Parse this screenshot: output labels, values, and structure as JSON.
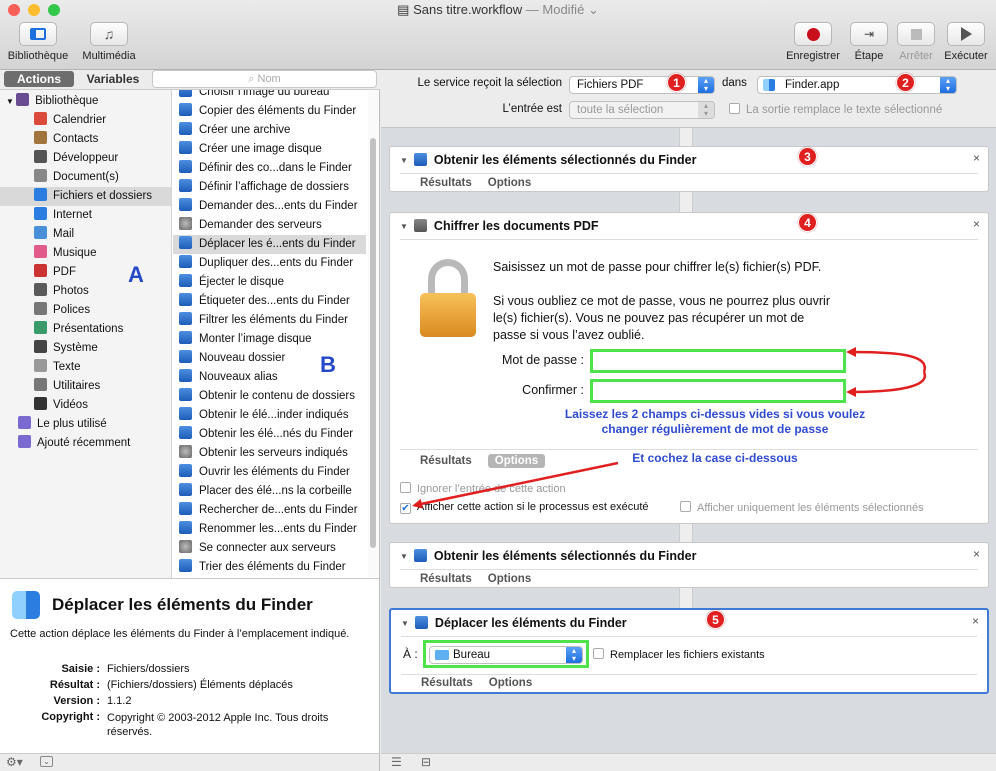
{
  "window": {
    "title": "Sans titre.workflow",
    "status": "— Modifié"
  },
  "toolbar": {
    "left": [
      {
        "label": "Bibliothèque"
      },
      {
        "label": "Multimédia"
      }
    ],
    "right": [
      {
        "label": "Enregistrer"
      },
      {
        "label": "Étape"
      },
      {
        "label": "Arrêter"
      },
      {
        "label": "Exécuter"
      }
    ]
  },
  "left": {
    "tab_actions": "Actions",
    "tab_variables": "Variables",
    "search_placeholder": "Nom",
    "library": [
      "Bibliothèque",
      "Calendrier",
      "Contacts",
      "Développeur",
      "Document(s)",
      "Fichiers et dossiers",
      "Internet",
      "Mail",
      "Musique",
      "PDF",
      "Photos",
      "Polices",
      "Présentations",
      "Système",
      "Texte",
      "Utilitaires",
      "Vidéos",
      "Le plus utilisé",
      "Ajouté récemment"
    ],
    "actions": [
      "Choisir l’image du bureau",
      "Copier des éléments du Finder",
      "Créer une archive",
      "Créer une image disque",
      "Définir des co...dans le Finder",
      "Définir l’affichage de dossiers",
      "Demander des...ents du Finder",
      "Demander des serveurs",
      "Déplacer les é...ents du Finder",
      "Dupliquer des...ents du Finder",
      "Éjecter le disque",
      "Étiqueter des...ents du Finder",
      "Filtrer les éléments du Finder",
      "Monter l’image disque",
      "Nouveau dossier",
      "Nouveaux alias",
      "Obtenir le contenu de dossiers",
      "Obtenir le élé...inder indiqués",
      "Obtenir les élé...nés du Finder",
      "Obtenir les serveurs indiqués",
      "Ouvrir les éléments du Finder",
      "Placer des élé...ns la corbeille",
      "Rechercher de...ents du Finder",
      "Renommer les...ents du Finder",
      "Se connecter aux serveurs",
      "Trier des éléments du Finder"
    ],
    "annot_a": "A",
    "annot_b": "B",
    "desc": {
      "title": "Déplacer les éléments du Finder",
      "text": "Cette action déplace les éléments du Finder à l’emplacement indiqué.",
      "saisie_label": "Saisie :",
      "saisie": "Fichiers/dossiers",
      "resultat_label": "Résultat :",
      "resultat": "(Fichiers/dossiers) Éléments déplacés",
      "version_label": "Version :",
      "version": "1.1.2",
      "copyright_label": "Copyright :",
      "copyright": "Copyright © 2003-2012 Apple Inc. Tous droits réservés."
    }
  },
  "service": {
    "receives_label": "Le service reçoit la sélection",
    "receives_value": "Fichiers PDF",
    "in_label": "dans",
    "app_value": "Finder.app",
    "input_label": "L’entrée est",
    "input_value": "toute la sélection",
    "replace_label": "La sortie remplace le texte sélectionné"
  },
  "cards": {
    "c1": {
      "title": "Obtenir les éléments sélectionnés du Finder",
      "tab1": "Résultats",
      "tab2": "Options"
    },
    "c2": {
      "title": "Chiffrer les documents PDF",
      "tab1": "Résultats",
      "tab2": "Options",
      "text1": "Saisissez un mot de passe pour chiffrer le(s) fichier(s) PDF.",
      "text2": "Si vous oubliez ce mot de passe, vous ne pourrez plus ouvrir le(s) fichier(s). Vous ne pouvez pas récupérer un mot de passe si vous l’avez oublié.",
      "password_label": "Mot de passe :",
      "confirm_label": "Confirmer :",
      "ignore_label": "Ignorer l’entrée de cette action",
      "show_label": "Afficher cette action si le processus est exécuté",
      "show_only_label": "Afficher uniquement les éléments sélectionnés"
    },
    "c3": {
      "title": "Obtenir les éléments sélectionnés du Finder",
      "tab1": "Résultats",
      "tab2": "Options"
    },
    "c4": {
      "title": "Déplacer les éléments du Finder",
      "tab1": "Résultats",
      "tab2": "Options",
      "to_label": "À :",
      "to_value": "Bureau",
      "replace_label": "Remplacer les fichiers existants"
    }
  },
  "annotations": {
    "b1": "1",
    "b2": "2",
    "b3": "3",
    "b4": "4",
    "b5": "5",
    "note1": "Laissez les 2 champs ci-dessus vides si vous voulez changer régulièrement de mot de passe",
    "note2": "Et cochez la case ci-dessous"
  },
  "colors": {
    "annotation_red": "#e02020",
    "annotation_blue": "#2f4bd0",
    "highlight_green": "#4ee34a"
  }
}
